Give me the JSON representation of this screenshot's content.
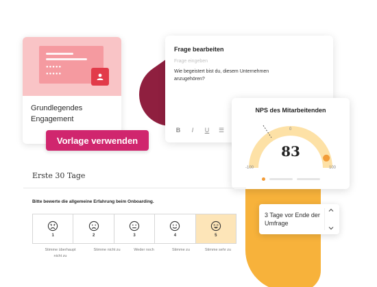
{
  "template": {
    "title": "Grundlegendes Engagement",
    "use_button": "Vorlage verwenden",
    "icon": "user-icon"
  },
  "editor": {
    "title": "Frage bearbeiten",
    "placeholder": "Frage eingeben",
    "question": "Wie begeistert bist du, diesem Unternehmen anzugehören?",
    "toolbar": [
      {
        "icon": "bold-icon",
        "label": "B"
      },
      {
        "icon": "italic-icon",
        "label": "I"
      },
      {
        "icon": "underline-icon",
        "label": "U"
      },
      {
        "icon": "bullet-list-icon",
        "label": "☰"
      },
      {
        "icon": "numbered-list-icon",
        "label": "☰"
      }
    ]
  },
  "nps": {
    "title": "NPS des Mitarbeitenden",
    "score": "83",
    "min": "-100",
    "mid": "0",
    "max": "100",
    "score_value": 83,
    "colors": {
      "track": "#fde1a6",
      "marker": "#f29c38"
    }
  },
  "survey": {
    "section_title": "Erste 30 Tage",
    "question": "Bitte bewerte die allgemeine Erfahrung beim Onboarding.",
    "options": [
      {
        "num": "1",
        "label": "Stimme überhaupt nicht zu",
        "icon": "very-sad-face-icon"
      },
      {
        "num": "2",
        "label": "Stimme nicht zu",
        "icon": "sad-face-icon"
      },
      {
        "num": "3",
        "label": "Weder noch",
        "icon": "neutral-face-icon"
      },
      {
        "num": "4",
        "label": "Stimme zu",
        "icon": "happy-face-icon"
      },
      {
        "num": "5",
        "label": "Stimme sehr zu",
        "icon": "very-happy-face-icon"
      }
    ],
    "selected": "5"
  },
  "reminder": {
    "text": "3 Tage vor Ende der Umfrage"
  },
  "colors": {
    "brand_pink": "#d0266e",
    "accent_orange": "#f7b23b",
    "accent_red": "#8f1f3f",
    "selected_bg": "#fde5b8"
  }
}
